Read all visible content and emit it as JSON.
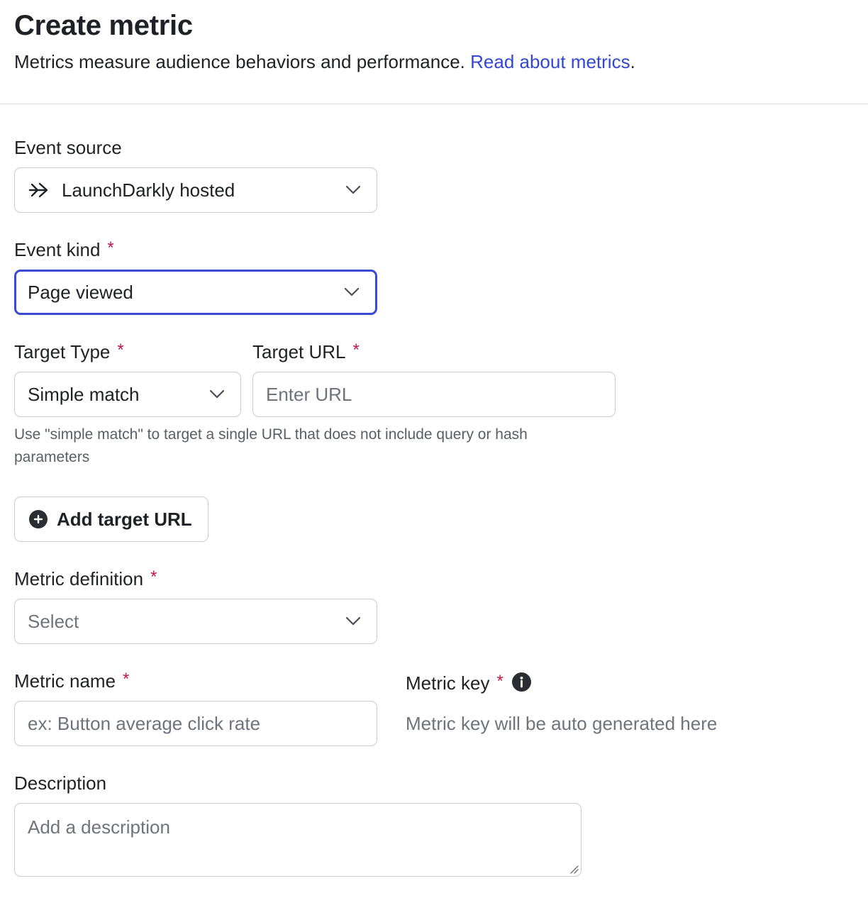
{
  "header": {
    "title": "Create metric",
    "subtitle": "Metrics measure audience behaviors and performance.",
    "link_text": "Read about metrics",
    "link_suffix": "."
  },
  "event_source": {
    "label": "Event source",
    "value": "LaunchDarkly hosted",
    "icon": "arrow-right-icon"
  },
  "event_kind": {
    "label": "Event kind",
    "required_mark": "*",
    "value": "Page viewed"
  },
  "target_type": {
    "label": "Target Type",
    "required_mark": "*",
    "value": "Simple match"
  },
  "target_url": {
    "label": "Target URL",
    "required_mark": "*",
    "placeholder": "Enter URL"
  },
  "helper_text": "Use \"simple match\" to target a single URL that does not include query or hash parameters",
  "add_target_url": {
    "label": "Add target URL",
    "icon": "plus-circle-icon"
  },
  "metric_definition": {
    "label": "Metric definition",
    "required_mark": "*",
    "placeholder": "Select"
  },
  "metric_name": {
    "label": "Metric name",
    "required_mark": "*",
    "placeholder": "ex: Button average click rate"
  },
  "metric_key": {
    "label": "Metric key",
    "required_mark": "*",
    "icon": "info-icon",
    "placeholder": "Metric key will be auto generated here"
  },
  "description": {
    "label": "Description",
    "placeholder": "Add a description"
  },
  "colors": {
    "link": "#3348d1",
    "focus_border": "#3a49d6",
    "required": "#c0174a",
    "border": "#c9cbd1",
    "placeholder": "#70737d"
  }
}
